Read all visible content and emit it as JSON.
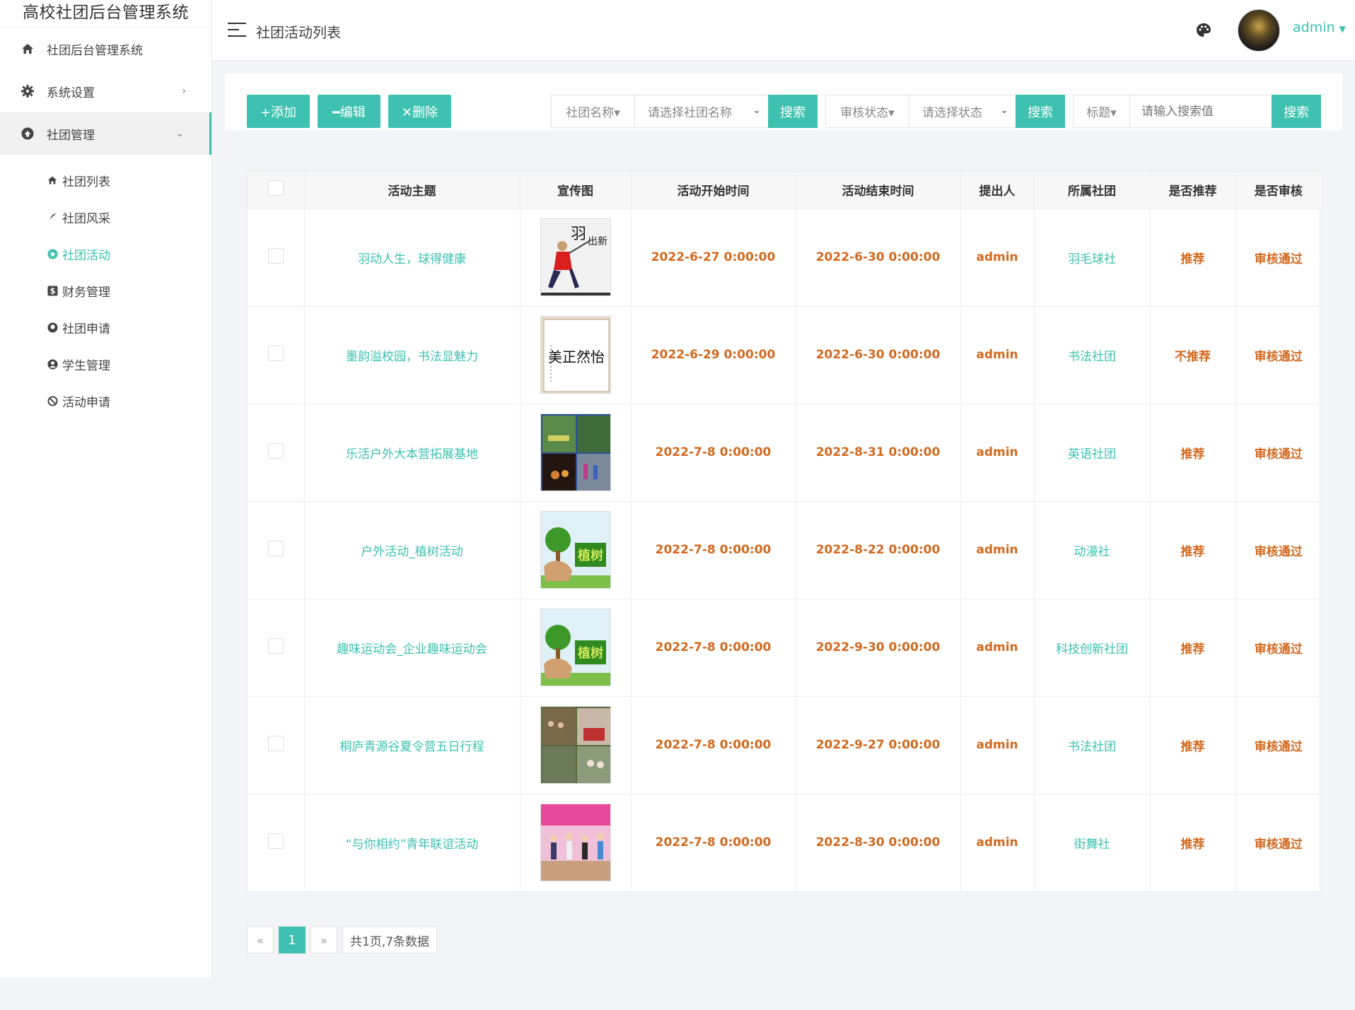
{
  "app": {
    "title": "高校社团后台管理系统"
  },
  "sidebar": {
    "items": [
      {
        "label": "社团后台管理系统",
        "icon": "home-icon"
      },
      {
        "label": "系统设置",
        "icon": "gear-icon"
      },
      {
        "label": "社团管理",
        "icon": "circle-arrow-icon"
      }
    ],
    "submenu": [
      {
        "label": "社团列表",
        "icon": "home-icon"
      },
      {
        "label": "社团风采",
        "icon": "feather-icon"
      },
      {
        "label": "社团活动",
        "icon": "star-circle-icon"
      },
      {
        "label": "财务管理",
        "icon": "dollar-icon"
      },
      {
        "label": "社团申请",
        "icon": "ball-icon"
      },
      {
        "label": "学生管理",
        "icon": "user-circle-icon"
      },
      {
        "label": "活动申请",
        "icon": "ban-icon"
      }
    ]
  },
  "header": {
    "title": "社团活动列表",
    "user": "admin"
  },
  "toolbar": {
    "add": "+添加",
    "edit": "━编辑",
    "delete": "✕删除"
  },
  "search": [
    {
      "label": "社团名称▾",
      "placeholder": "请选择社团名称",
      "button": "搜索"
    },
    {
      "label": "审核状态▾",
      "placeholder": "请选择状态",
      "button": "搜索"
    },
    {
      "label": "标题▾",
      "placeholder": "请输入搜索值",
      "button": "搜索"
    }
  ],
  "table": {
    "headers": [
      "活动主题",
      "宣传图",
      "活动开始时间",
      "活动结束时间",
      "提出人",
      "所属社团",
      "是否推荐",
      "是否审核"
    ],
    "rows": [
      {
        "theme": "羽动人生，球得健康",
        "start": "2022-6-27 0:00:00",
        "end": "2022-6-30 0:00:00",
        "person": "admin",
        "club": "羽毛球社",
        "recommend": "推荐",
        "audit": "审核通过"
      },
      {
        "theme": "墨韵溢校园，书法显魅力",
        "start": "2022-6-29 0:00:00",
        "end": "2022-6-30 0:00:00",
        "person": "admin",
        "club": "书法社团",
        "recommend": "不推荐",
        "audit": "审核通过"
      },
      {
        "theme": "乐活户外大本营拓展基地",
        "start": "2022-7-8 0:00:00",
        "end": "2022-8-31 0:00:00",
        "person": "admin",
        "club": "英语社团",
        "recommend": "推荐",
        "audit": "审核通过"
      },
      {
        "theme": "户外活动_植树活动",
        "start": "2022-7-8 0:00:00",
        "end": "2022-8-22 0:00:00",
        "person": "admin",
        "club": "动漫社",
        "recommend": "推荐",
        "audit": "审核通过"
      },
      {
        "theme": "趣味运动会_企业趣味运动会",
        "start": "2022-7-8 0:00:00",
        "end": "2022-9-30 0:00:00",
        "person": "admin",
        "club": "科技创新社团",
        "recommend": "推荐",
        "audit": "审核通过"
      },
      {
        "theme": "桐庐青源谷夏令营五日行程",
        "start": "2022-7-8 0:00:00",
        "end": "2022-9-27 0:00:00",
        "person": "admin",
        "club": "书法社团",
        "recommend": "推荐",
        "audit": "审核通过"
      },
      {
        "theme": "“与你相约”青年联谊活动",
        "start": "2022-7-8 0:00:00",
        "end": "2022-8-30 0:00:00",
        "person": "admin",
        "club": "街舞社",
        "recommend": "推荐",
        "audit": "审核通过"
      }
    ]
  },
  "pagination": {
    "prev": "«",
    "current": "1",
    "next": "»",
    "info": "共1页,7条数据"
  }
}
